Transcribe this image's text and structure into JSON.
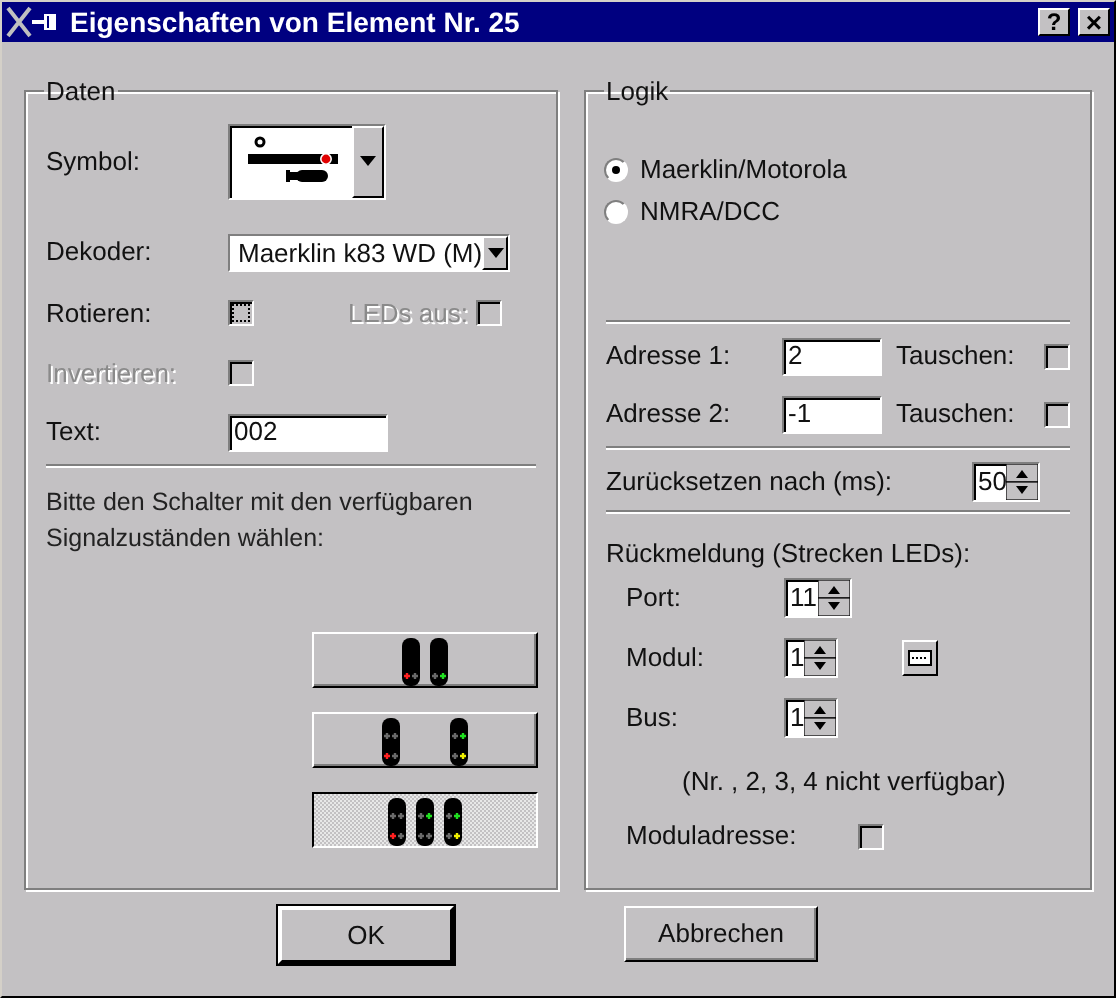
{
  "window": {
    "title": "Eigenschaften von Element Nr. 25",
    "title_buttons": [
      {
        "kind": "help",
        "label": "?"
      },
      {
        "kind": "close",
        "label": "×"
      }
    ]
  },
  "daten": {
    "title": "Daten",
    "symbol": {
      "label": "Symbol:"
    },
    "dekoder": {
      "label": "Dekoder:",
      "value": "Maerklin k83 WD (M)"
    },
    "rotieren": {
      "label": "Rotieren:",
      "checked": false,
      "focused": true
    },
    "leds_aus": {
      "label": "LEDs aus:",
      "checked": false,
      "disabled": true
    },
    "invertieren": {
      "label": "Invertieren:",
      "checked": false,
      "disabled": true
    },
    "text": {
      "label": "Text:",
      "value": "002"
    },
    "hint": "Bitte den Schalter mit den verfügbaren Signalzuständen wählen:",
    "signal_buttons": [
      {
        "kind": "two_masts_one_row",
        "selected": false
      },
      {
        "kind": "two_masts_two_rows",
        "selected": false
      },
      {
        "kind": "three_masts",
        "selected": true
      }
    ]
  },
  "logik": {
    "title": "Logik",
    "protocols": [
      {
        "label": "Maerklin/Motorola",
        "selected": true
      },
      {
        "label": "NMRA/DCC",
        "selected": false
      }
    ],
    "addresses": [
      {
        "label": "Adresse 1:",
        "value": "2",
        "swap_label": "Tauschen:",
        "swap_checked": false
      },
      {
        "label": "Adresse 2:",
        "value": "-1",
        "swap_label": "Tauschen:",
        "swap_checked": false
      }
    ],
    "reset": {
      "label": "Zurücksetzen nach (ms):",
      "value": "50"
    },
    "feedback": {
      "title": "Rückmeldung (Strecken LEDs):",
      "fields": [
        {
          "label": "Port:",
          "value": "11",
          "picker": false
        },
        {
          "label": "Modul:",
          "value": "1",
          "picker": true
        },
        {
          "label": "Bus:",
          "value": "1",
          "picker": false
        }
      ],
      "note": "(Nr. , 2, 3, 4 nicht verfügbar)",
      "moduladresse": {
        "label": "Moduladresse:",
        "checked": false
      }
    }
  },
  "buttons": [
    {
      "label": "OK",
      "default": true
    },
    {
      "label": "Abbrechen",
      "default": false
    }
  ]
}
